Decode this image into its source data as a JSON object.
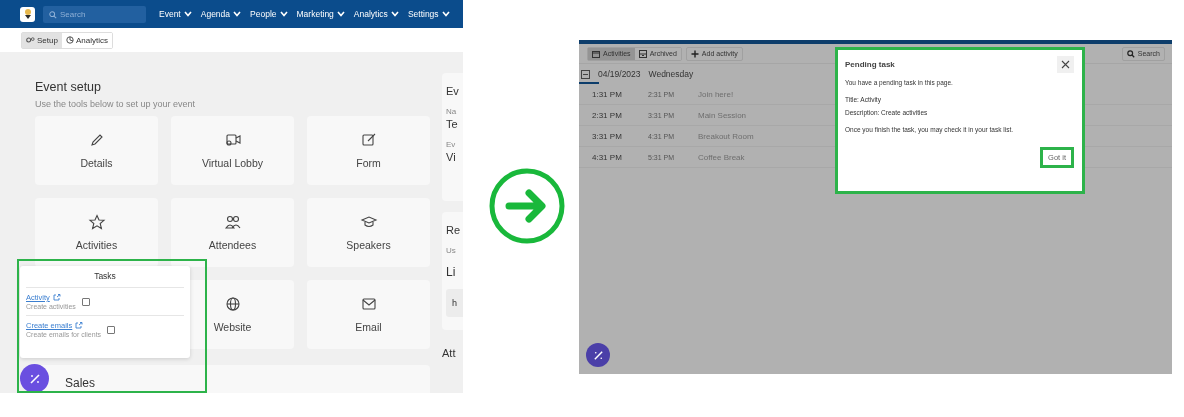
{
  "before": {
    "navbar": {
      "search": {
        "placeholder": "Search"
      },
      "menus": [
        "Event",
        "Agenda",
        "People",
        "Marketing",
        "Analytics",
        "Settings"
      ]
    },
    "tabs": [
      {
        "label": "Setup",
        "kind": "gears",
        "selected": true
      },
      {
        "label": "Analytics",
        "kind": "chart",
        "selected": false
      }
    ],
    "setup": {
      "title": "Event setup",
      "subtitle": "Use the tools below to set up your event",
      "cards": [
        {
          "label": "Details",
          "kind": "pencil"
        },
        {
          "label": "Virtual Lobby",
          "kind": "video"
        },
        {
          "label": "Form",
          "kind": "form"
        },
        {
          "label": "Activities",
          "kind": "star"
        },
        {
          "label": "Attendees",
          "kind": "people"
        },
        {
          "label": "Speakers",
          "kind": "cap"
        },
        {
          "label": "Website",
          "kind": "globe"
        },
        {
          "label": "Email",
          "kind": "mail"
        }
      ],
      "next_section": "Sales"
    },
    "side": {
      "card_1": {
        "title": "Ev",
        "fields": [
          {
            "label": "Na",
            "value": "Te"
          },
          {
            "label": "Ev",
            "value": "Vi"
          }
        ]
      },
      "card_2": {
        "title": "Re",
        "text": "Us",
        "heading": "Li",
        "field_value": "h"
      },
      "heading": "Att"
    },
    "tasks": {
      "title": "Tasks",
      "items": [
        {
          "link": "Activity",
          "description": "Create activities",
          "checked": false
        },
        {
          "link": "Create emails",
          "description": "Create emails for clients",
          "checked": false
        }
      ]
    }
  },
  "after": {
    "toolbar": {
      "tabs": [
        {
          "label": "Activities",
          "kind": "calendar",
          "selected": true
        },
        {
          "label": "Archived",
          "kind": "archive",
          "selected": false
        }
      ],
      "add_button": "Add activity",
      "search_button": "Search"
    },
    "group": {
      "date": "04/19/2023",
      "weekday": "Wednesday",
      "expanded": true
    },
    "rows": [
      {
        "start": "1:31 PM",
        "end": "2:31 PM",
        "title": "Join here!"
      },
      {
        "start": "2:31 PM",
        "end": "3:31 PM",
        "title": "Main Session"
      },
      {
        "start": "3:31 PM",
        "end": "4:31 PM",
        "title": "Breakout Room"
      },
      {
        "start": "4:31 PM",
        "end": "5:31 PM",
        "title": "Coffee Break"
      }
    ],
    "dialog": {
      "title": "Pending task",
      "paragraphs": [
        [
          "You have a pending task in this page."
        ],
        [
          "Title: Activity",
          "Description: Create activities"
        ],
        [
          "Once you finish the task, you may check it in your task list."
        ]
      ],
      "button": "Got it"
    }
  }
}
